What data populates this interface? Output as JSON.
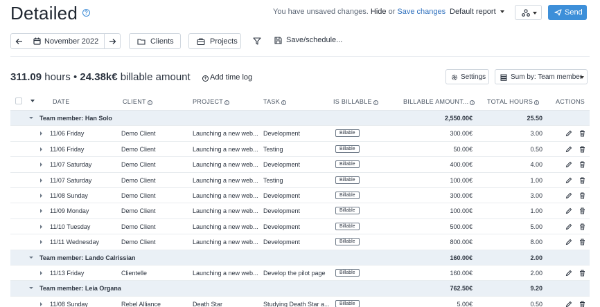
{
  "header": {
    "title": "Detailed",
    "unsaved_text": "You have unsaved changes.",
    "hide_link": "Hide",
    "or_text": "or",
    "save_changes_link": "Save changes",
    "report_select": "Default report",
    "send_label": "Send"
  },
  "toolbar": {
    "period": "November 2022",
    "clients_label": "Clients",
    "projects_label": "Projects",
    "save_schedule_label": "Save/schedule..."
  },
  "summary": {
    "hours_value": "311.09",
    "hours_unit": "hours",
    "separator": "•",
    "amount_value": "24.38k€",
    "amount_unit": "billable amount",
    "add_time_log": "Add time log",
    "settings_label": "Settings",
    "sum_by_label": "Sum by: Team member"
  },
  "table": {
    "columns": {
      "date": "DATE",
      "client": "CLIENT",
      "project": "PROJECT",
      "task": "TASK",
      "is_billable": "IS BILLABLE",
      "billable_amount": "BILLABLE AMOUNT...",
      "total_hours": "TOTAL HOURS",
      "actions": "ACTIONS"
    },
    "rows": [
      {
        "kind": "group",
        "label": "Team member: Han Solo",
        "amount": "2,550.00€",
        "hours": "25.50"
      },
      {
        "kind": "entry",
        "date": "11/06 Friday",
        "client": "Demo Client",
        "project": "Launching a new web...",
        "task": "Development",
        "billable": "Billable",
        "amount": "300.00€",
        "hours": "3.00"
      },
      {
        "kind": "entry",
        "date": "11/06 Friday",
        "client": "Demo Client",
        "project": "Launching a new web...",
        "task": "Testing",
        "billable": "Billable",
        "amount": "50.00€",
        "hours": "0.50"
      },
      {
        "kind": "entry",
        "date": "11/07 Saturday",
        "client": "Demo Client",
        "project": "Launching a new web...",
        "task": "Development",
        "billable": "Billable",
        "amount": "400.00€",
        "hours": "4.00"
      },
      {
        "kind": "entry",
        "date": "11/07 Saturday",
        "client": "Demo Client",
        "project": "Launching a new web...",
        "task": "Testing",
        "billable": "Billable",
        "amount": "100.00€",
        "hours": "1.00"
      },
      {
        "kind": "entry",
        "date": "11/08 Sunday",
        "client": "Demo Client",
        "project": "Launching a new web...",
        "task": "Development",
        "billable": "Billable",
        "amount": "300.00€",
        "hours": "3.00"
      },
      {
        "kind": "entry",
        "date": "11/09 Monday",
        "client": "Demo Client",
        "project": "Launching a new web...",
        "task": "Development",
        "billable": "Billable",
        "amount": "100.00€",
        "hours": "1.00"
      },
      {
        "kind": "entry",
        "date": "11/10 Tuesday",
        "client": "Demo Client",
        "project": "Launching a new web...",
        "task": "Development",
        "billable": "Billable",
        "amount": "500.00€",
        "hours": "5.00"
      },
      {
        "kind": "entry",
        "date": "11/11 Wednesday",
        "client": "Demo Client",
        "project": "Launching a new web...",
        "task": "Development",
        "billable": "Billable",
        "amount": "800.00€",
        "hours": "8.00"
      },
      {
        "kind": "group",
        "label": "Team member: Lando Calrissian",
        "amount": "160.00€",
        "hours": "2.00"
      },
      {
        "kind": "entry",
        "date": "11/13 Friday",
        "client": "Clientelle",
        "project": "Launching a new web...",
        "task": "Develop the pilot page",
        "billable": "Billable",
        "amount": "160.00€",
        "hours": "2.00"
      },
      {
        "kind": "group",
        "label": "Team member: Leia Organa",
        "amount": "762.50€",
        "hours": "9.20"
      },
      {
        "kind": "entry",
        "date": "11/08 Sunday",
        "client": "Rebel Alliance",
        "project": "Death Star",
        "task": "Studying Death Star a...",
        "billable": "Billable",
        "amount": "5.00€",
        "hours": "0.50"
      }
    ]
  },
  "colors": {
    "accent": "#3d8fd9",
    "group_row": "#eaf0f6",
    "link": "#2d6fbd"
  }
}
